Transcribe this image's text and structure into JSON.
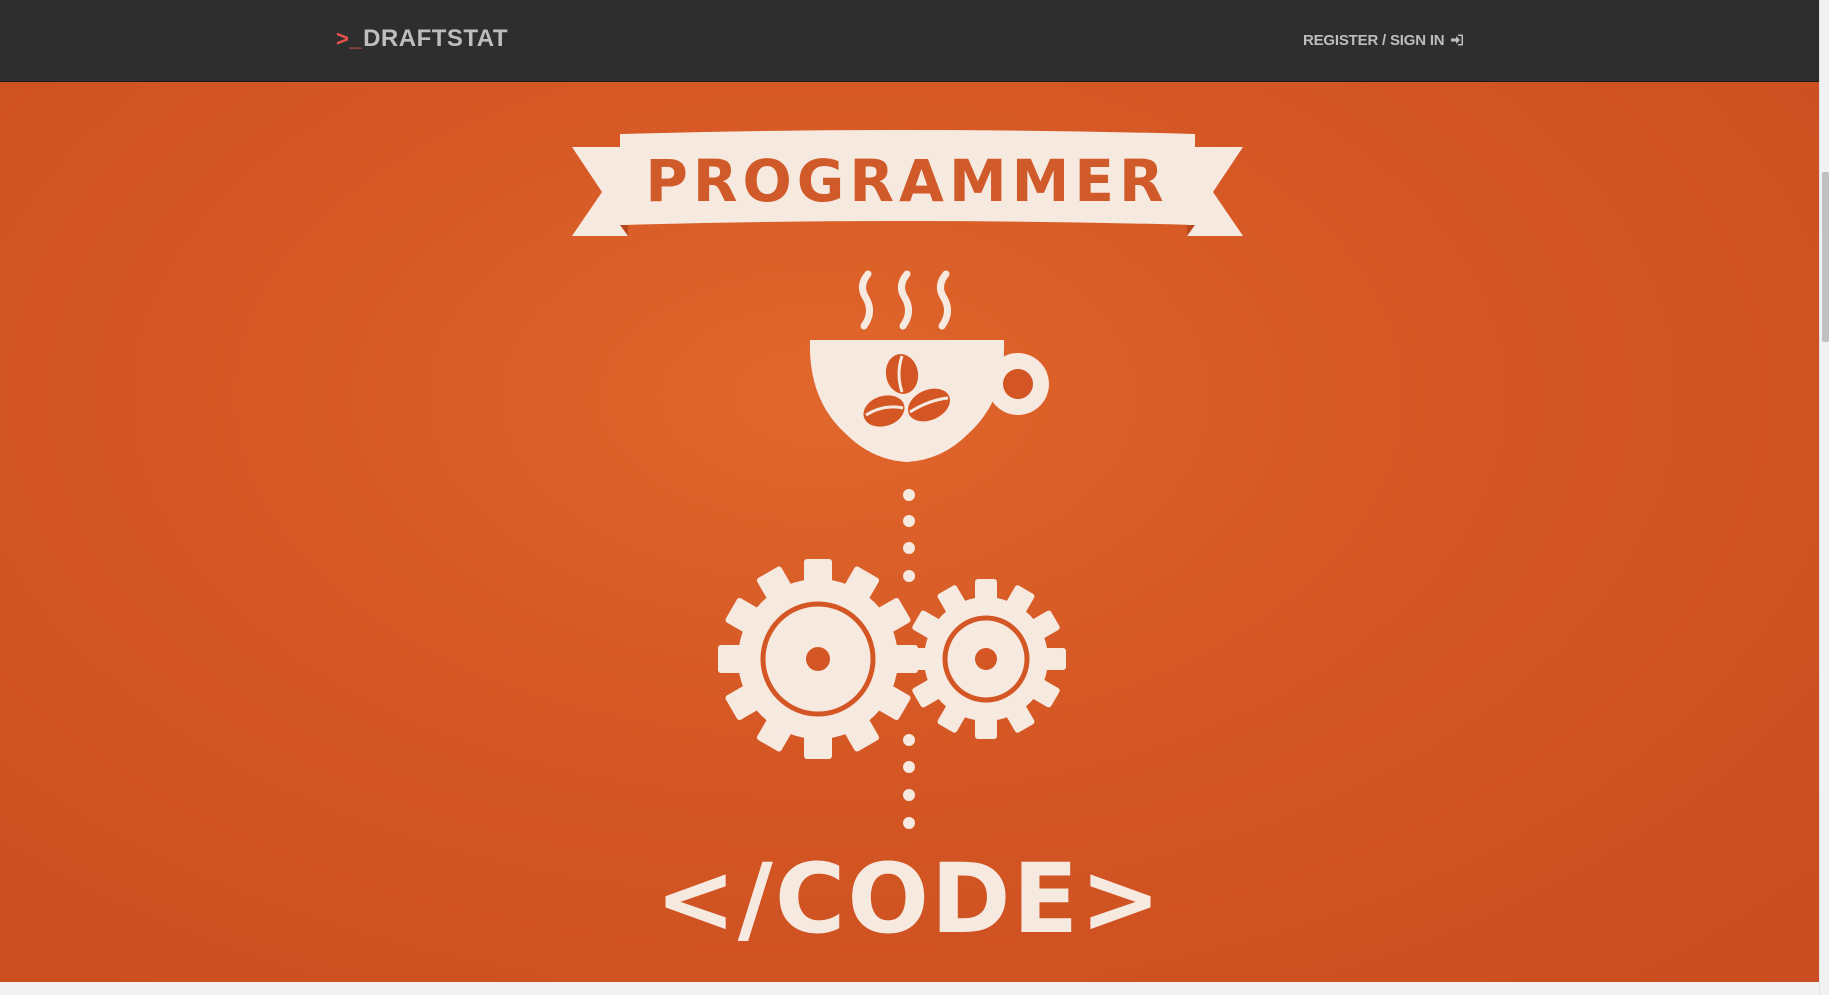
{
  "navbar": {
    "brand_prompt": ">_",
    "brand_name": "DRAFTSTAT",
    "auth_label": "REGISTER / SIGN IN",
    "auth_icon": "sign-in-icon"
  },
  "hero": {
    "banner_text": "PROGRAMMER",
    "code_text": "</CODE>",
    "icons": [
      "coffee-cup-icon",
      "coffee-beans-icon",
      "steam-icon",
      "gear-icon",
      "dotted-connector"
    ],
    "colors": {
      "background": "#d45624",
      "artwork": "#f6e9e0"
    }
  },
  "colors": {
    "navbar_bg": "#2e2e2e",
    "brand_prompt": "#e8544a",
    "nav_text": "#bdbdbd"
  }
}
